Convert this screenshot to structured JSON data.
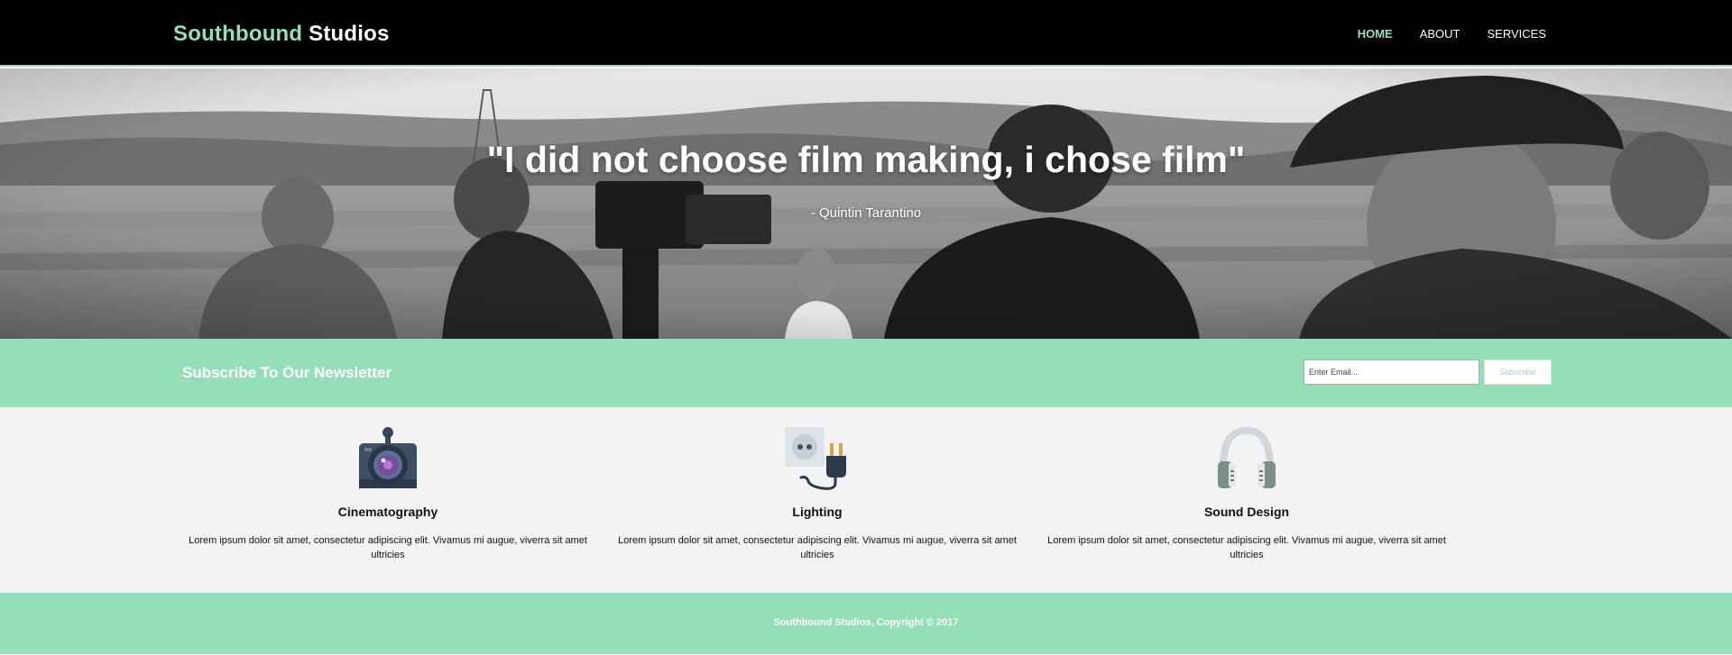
{
  "header": {
    "brand_highlight": "Southbound",
    "brand_rest": " Studios",
    "nav": [
      {
        "label": "HOME",
        "active": true
      },
      {
        "label": "ABOUT",
        "active": false
      },
      {
        "label": "SERVICES",
        "active": false
      }
    ]
  },
  "showcase": {
    "quote": "\"I did not choose film making, i chose film\"",
    "author": "- Quintin Tarantino",
    "image": "black-and-white photo of a film crew with camera outdoors"
  },
  "newsletter": {
    "title": "Subscribe To Our Newsletter",
    "email_placeholder": "Enter Email...",
    "email_value": "",
    "button_label": "Subscribe"
  },
  "boxes": [
    {
      "icon": "camera-icon",
      "title": "Cinematography",
      "text": "Lorem ipsum dolor sit amet, consectetur adipiscing elit. Vivamus mi augue, viverra sit amet ultricies"
    },
    {
      "icon": "plug-socket-icon",
      "title": "Lighting",
      "text": "Lorem ipsum dolor sit amet, consectetur adipiscing elit. Vivamus mi augue, viverra sit amet ultricies"
    },
    {
      "icon": "headphones-icon",
      "title": "Sound Design",
      "text": "Lorem ipsum dolor sit amet, consectetur adipiscing elit. Vivamus mi augue, viverra sit amet ultricies"
    }
  ],
  "footer": {
    "copyright": "Southbound Studios, Copyright © 2017"
  },
  "colors": {
    "accent": "#93e0b8",
    "header_bg": "#000000",
    "band_bg": "#95dfb8",
    "boxes_bg": "#f3f3f3"
  }
}
